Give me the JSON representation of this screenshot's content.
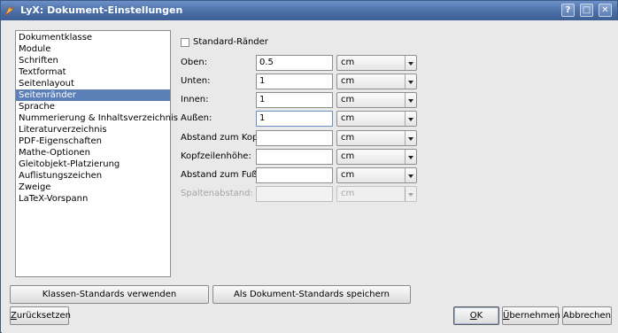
{
  "window": {
    "title": "LyX: Dokument-Einstellungen",
    "buttons": {
      "help": "?",
      "maximize": "□",
      "close": "✕"
    }
  },
  "sidebar": {
    "items": [
      "Dokumentklasse",
      "Module",
      "Schriften",
      "Textformat",
      "Seitenlayout",
      "Seitenränder",
      "Sprache",
      "Nummerierung & Inhaltsverzeichnis",
      "Literaturverzeichnis",
      "PDF-Eigenschaften",
      "Mathe-Optionen",
      "Gleitobjekt-Platzierung",
      "Auflistungszeichen",
      "Zweige",
      "LaTeX-Vorspann"
    ],
    "selected": "Seitenränder"
  },
  "margins": {
    "default_checkbox": {
      "label": "Standard-Ränder",
      "checked": false
    },
    "rows": [
      {
        "label": "Oben:",
        "value": "0.5",
        "unit": "cm",
        "enabled": true,
        "focused": false
      },
      {
        "label": "Unten:",
        "value": "1",
        "unit": "cm",
        "enabled": true,
        "focused": false
      },
      {
        "label": "Innen:",
        "value": "1",
        "unit": "cm",
        "enabled": true,
        "focused": false
      },
      {
        "label": "Außen:",
        "value": "1",
        "unit": "cm",
        "enabled": true,
        "focused": true
      },
      {
        "label": "Abstand zum Kopf:",
        "value": "",
        "unit": "cm",
        "enabled": true,
        "focused": false
      },
      {
        "label": "Kopfzeilenhöhe:",
        "value": "",
        "unit": "cm",
        "enabled": true,
        "focused": false
      },
      {
        "label": "Abstand zum Fuß:",
        "value": "",
        "unit": "cm",
        "enabled": true,
        "focused": false
      },
      {
        "label": "Spaltenabstand:",
        "value": "",
        "unit": "cm",
        "enabled": false,
        "focused": false
      }
    ]
  },
  "buttons": {
    "class_defaults": "Klassen-Standards verwenden",
    "save_defaults": "Als Dokument-Standards speichern",
    "reset": "Zurücksetzen",
    "ok": "OK",
    "apply": "Übernehmen",
    "cancel": "Abbrechen"
  },
  "colors": {
    "titlebar": "#4a6ea6",
    "selection": "#5c7fb8"
  }
}
